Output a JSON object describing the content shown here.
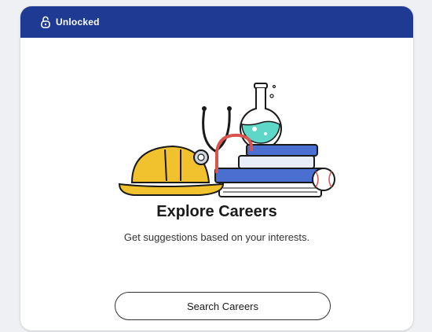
{
  "card": {
    "status_icon": "unlocked-lock-icon",
    "status_label": "Unlocked",
    "illustration": "careers-illustration",
    "title": "Explore Careers",
    "description": "Get suggestions based on your interests.",
    "button_label": "Search Careers"
  },
  "colors": {
    "header_background": "#1f3a93",
    "hard_hat": "#f2c12e",
    "stethoscope": "#d9534f",
    "book_blue": "#4a6fd1",
    "flask_liquid": "#5ed6c8"
  }
}
